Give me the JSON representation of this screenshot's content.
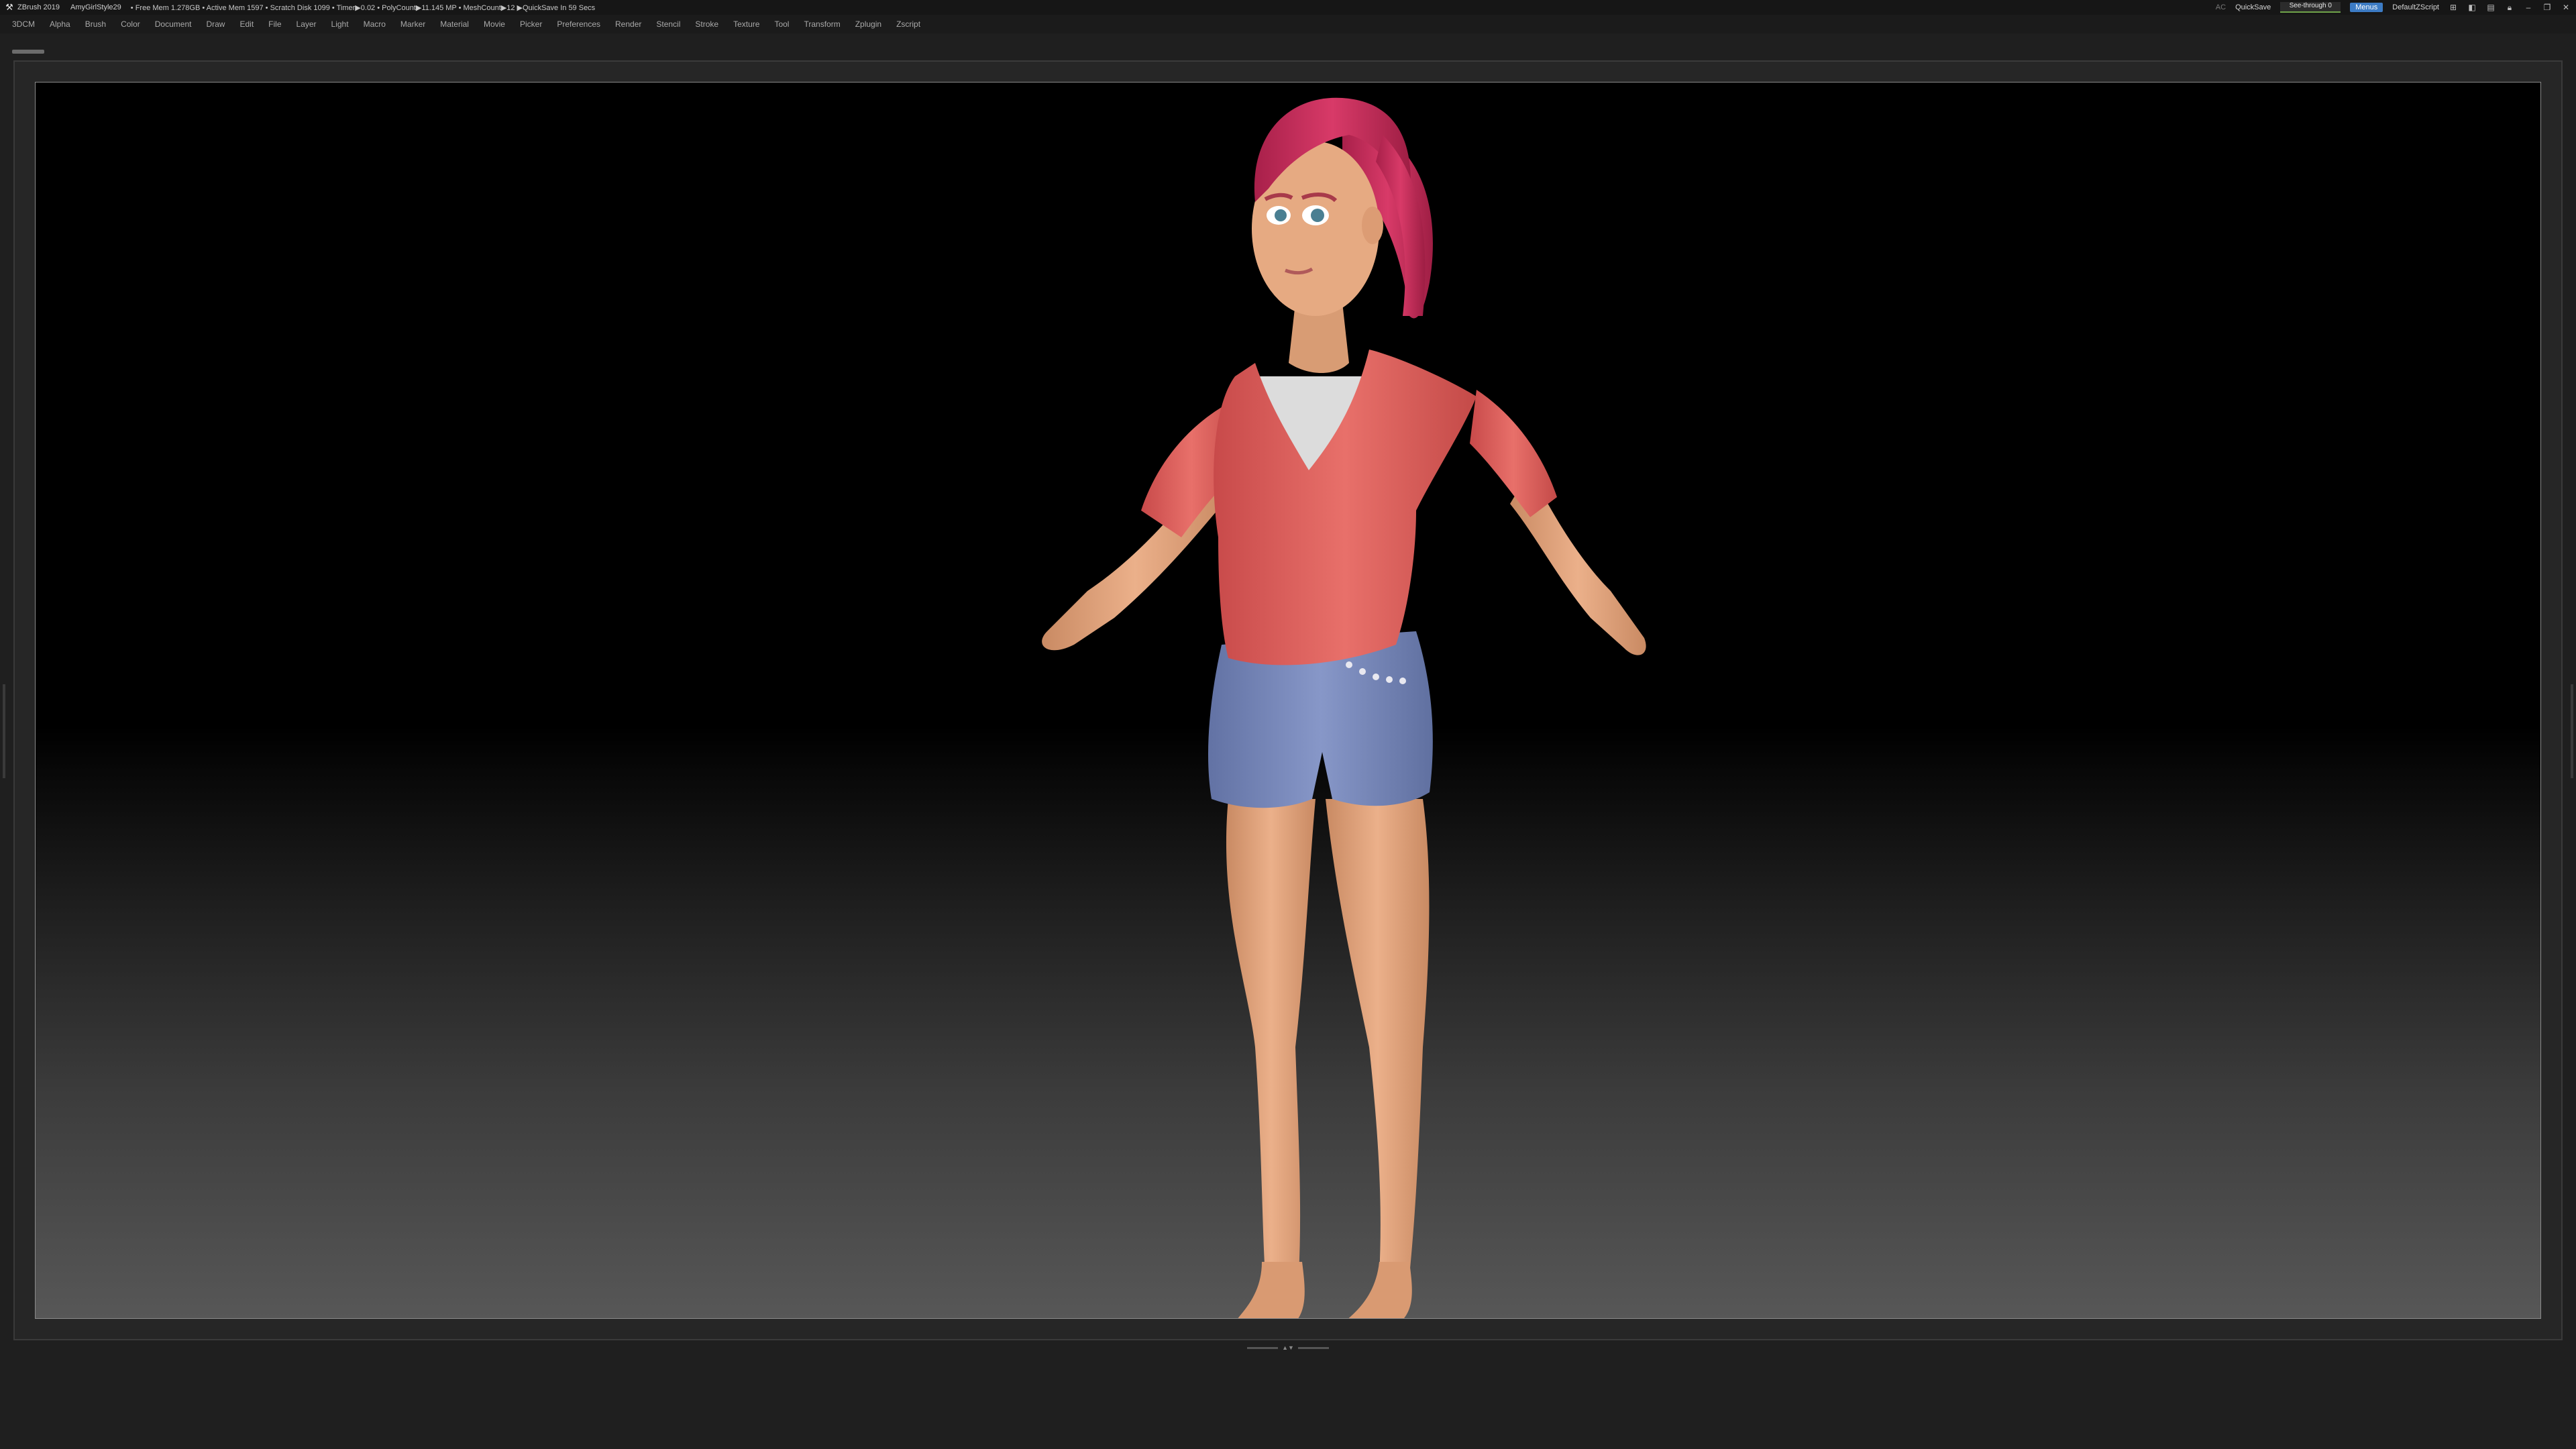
{
  "titlebar": {
    "app": "ZBrush 2019",
    "document": "AmyGirlStyle29",
    "stats": "• Free Mem 1.278GB • Active Mem 1597 • Scratch Disk 1099 • Timer▶0.02 • PolyCount▶11.145 MP • MeshCount▶12 ▶QuickSave In 59 Secs",
    "ac_label": "AC",
    "quicksave_label": "QuickSave",
    "seethrough_label": "See-through",
    "seethrough_value": "0",
    "menus_label": "Menus",
    "default_script_label": "DefaultZScript"
  },
  "menubar": {
    "items": [
      "3DCM",
      "Alpha",
      "Brush",
      "Color",
      "Document",
      "Draw",
      "Edit",
      "File",
      "Layer",
      "Light",
      "Macro",
      "Marker",
      "Material",
      "Movie",
      "Picker",
      "Preferences",
      "Render",
      "Stencil",
      "Stroke",
      "Texture",
      "Tool",
      "Transform",
      "Zplugin",
      "Zscript"
    ]
  },
  "colors": {
    "accent_blue": "#3c7bc4",
    "seethrough_green": "#6fa34a",
    "hair": "#c42d5c",
    "jacket": "#e2605e",
    "shorts": "#7f8fc0",
    "skin": "#e2a47c"
  },
  "icons": {
    "app_logo": "zbrush-logo-icon",
    "title_right": [
      "window-layout-icon",
      "palette-icon",
      "script-icon",
      "lock-icon",
      "minimize-icon",
      "restore-icon",
      "close-icon"
    ]
  }
}
